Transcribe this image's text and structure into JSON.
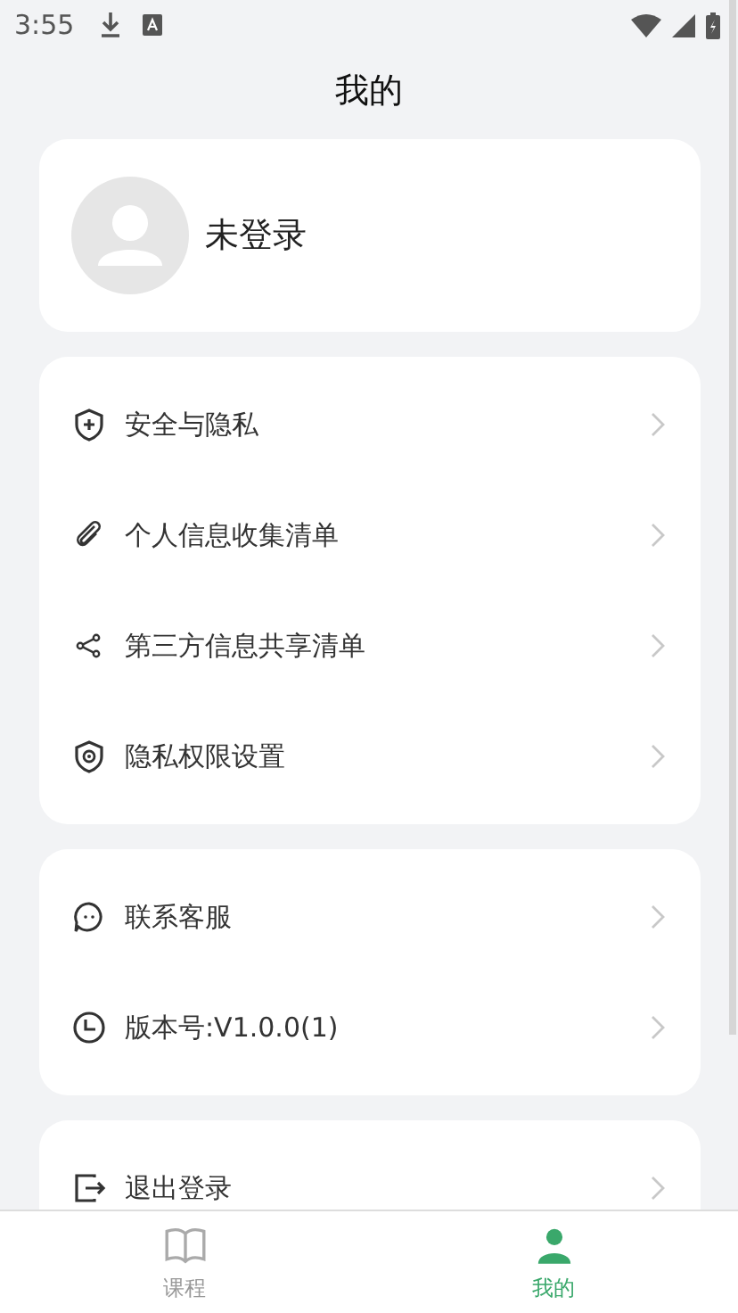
{
  "status_bar": {
    "time": "3:55"
  },
  "title": "我的",
  "profile": {
    "name": "未登录"
  },
  "menu_groups": [
    {
      "items": [
        {
          "label": "安全与隐私"
        },
        {
          "label": "个人信息收集清单"
        },
        {
          "label": "第三方信息共享清单"
        },
        {
          "label": "隐私权限设置"
        }
      ]
    },
    {
      "items": [
        {
          "label": "联系客服"
        },
        {
          "label": "版本号:V1.0.0(1)"
        }
      ]
    },
    {
      "items": [
        {
          "label": "退出登录"
        }
      ]
    }
  ],
  "tab_bar": [
    {
      "label": "课程",
      "selected": false
    },
    {
      "label": "我的",
      "selected": true
    }
  ]
}
